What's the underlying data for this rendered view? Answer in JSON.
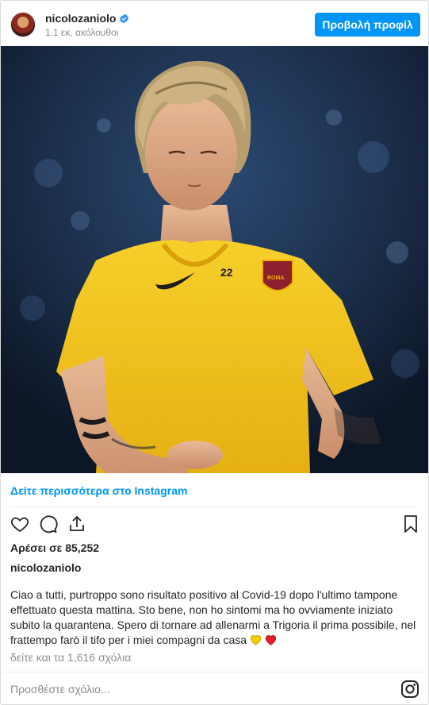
{
  "header": {
    "username": "nicolozaniolo",
    "verified": true,
    "followers": "1.1 εκ. ακόλουθοι",
    "view_profile_label": "Προβολή προφίλ"
  },
  "photo": {
    "description": "player-photo",
    "jersey_number": "22",
    "badge_text": "ROMA"
  },
  "more_link": "Δείτε περισσότερα στο Instagram",
  "actions": {
    "icons": [
      "heart-icon",
      "comment-icon",
      "share-icon",
      "bookmark-icon"
    ]
  },
  "likes": "Αρέσει σε 85,252",
  "caption": {
    "username": "nicolozaniolo",
    "text": "Ciao a tutti, purtroppo sono risultato positivo al Covid-19 dopo l'ultimo tampone effettuato questa mattina. Sto bene, non ho sintomi ma ho ovviamente iniziato subito la quarantena. Spero di tornare ad allenarmi a Trigoria il prima possibile, nel frattempo farò il tifo per i miei compagni da casa",
    "emojis": [
      "💛",
      "❤️"
    ]
  },
  "comments_link": "δείτε και τα 1,616 σχόλια",
  "comment_input": {
    "placeholder": "Προσθέστε σχόλιο..."
  },
  "colors": {
    "accent": "#0095f6",
    "jersey": "#f2c21a",
    "text": "#262626",
    "muted": "#8e8e8e"
  }
}
